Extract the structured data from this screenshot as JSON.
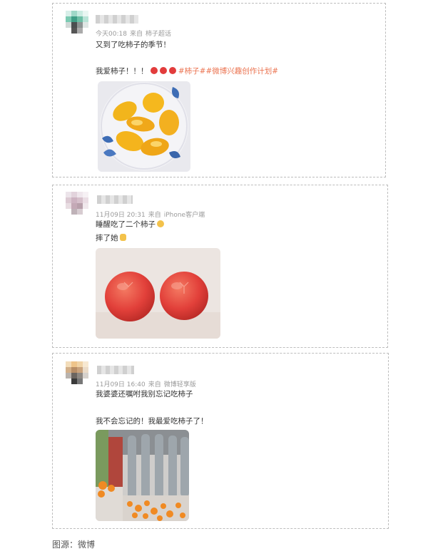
{
  "posts": [
    {
      "time": "今天00:18",
      "source_prefix": "来自",
      "source": "柿子超话",
      "line1": "又到了吃柿子的季节！",
      "line2_text": "我爱柿子！！！",
      "hashtags": "#柿子##微博兴趣创作计划#"
    },
    {
      "time": "11月09日 20:31",
      "source_prefix": "来自",
      "source": "iPhone客户端",
      "line1": "睡醒吃了二个柿子",
      "line2_text": "摔了她"
    },
    {
      "time": "11月09日 16:40",
      "source_prefix": "来自",
      "source": "微博轻享版",
      "line1": "我婆婆还嘱咐我别忘记吃柿子",
      "line2_text": "我不会忘记的！我最爱吃柿子了！"
    }
  ],
  "caption": "图源：微博",
  "colors": {
    "hashtag": "#eb7350",
    "meta": "#9a9a9a"
  },
  "icons": [
    "persimmon-emoji-icon",
    "smile-emoji-icon",
    "victory-hand-emoji-icon"
  ]
}
